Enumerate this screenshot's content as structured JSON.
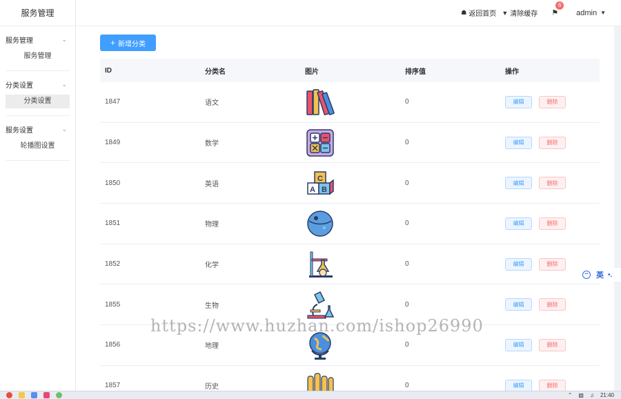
{
  "sidebar": {
    "brand": "服务管理",
    "groups": [
      {
        "title": "服务管理",
        "item": "服务管理"
      },
      {
        "title": "分类设置",
        "item": "分类设置"
      },
      {
        "title": "服务设置",
        "item": "轮播图设置"
      }
    ]
  },
  "header": {
    "home_link": "返回首页",
    "clear_cache": "清除缓存",
    "notification_count": "6",
    "user": "admin"
  },
  "toolbar": {
    "add_label": "新增分类"
  },
  "table": {
    "headers": [
      "ID",
      "分类名",
      "图片",
      "排序值",
      "操作"
    ],
    "edit_label": "编辑",
    "delete_label": "删除",
    "rows": [
      {
        "id": "1847",
        "name": "语文",
        "icon": "books-icon",
        "sort": "0"
      },
      {
        "id": "1849",
        "name": "数学",
        "icon": "calculator-icon",
        "sort": "0"
      },
      {
        "id": "1850",
        "name": "英语",
        "icon": "abc-blocks-icon",
        "sort": "0"
      },
      {
        "id": "1851",
        "name": "物理",
        "icon": "planet-icon",
        "sort": "0"
      },
      {
        "id": "1852",
        "name": "化学",
        "icon": "lab-flask-icon",
        "sort": "0"
      },
      {
        "id": "1855",
        "name": "生物",
        "icon": "microscope-icon",
        "sort": "0"
      },
      {
        "id": "1856",
        "name": "地理",
        "icon": "globe-icon",
        "sort": "0"
      },
      {
        "id": "1857",
        "name": "历史",
        "icon": "scrolls-icon",
        "sort": "0"
      }
    ]
  },
  "watermark": "https://www.huzhan.com/ishop26990",
  "ime": {
    "label": "英"
  },
  "taskbar": {
    "clock": "21:40"
  }
}
